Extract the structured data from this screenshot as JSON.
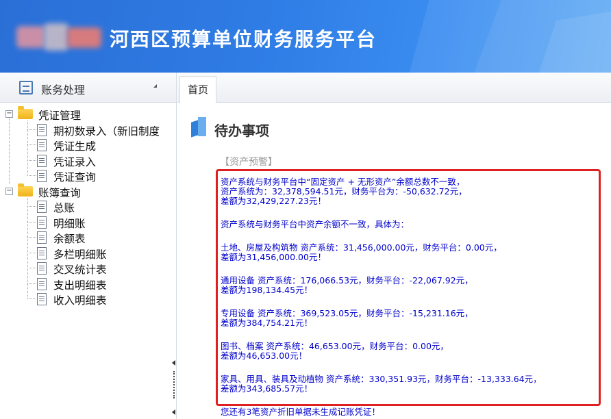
{
  "header": {
    "title": "河西区预算单位财务服务平台"
  },
  "sidebar": {
    "module_label": "账务处理",
    "groups": [
      {
        "label": "凭证管理",
        "expander": "−",
        "items": [
          "期初数录入（新旧制度",
          "凭证生成",
          "凭证录入",
          "凭证查询"
        ]
      },
      {
        "label": "账簿查询",
        "expander": "−",
        "items": [
          "总账",
          "明细账",
          "余额表",
          "多栏明细账",
          "交叉统计表",
          "支出明细表",
          "收入明细表"
        ]
      }
    ]
  },
  "tabs": [
    {
      "label": "首页"
    }
  ],
  "main": {
    "todo_title": "待办事项",
    "section_label": "【资产预警】",
    "alerts": [
      {
        "lines": [
          "资产系统与财务平台中“固定资产 + 无形资产”余额总数不一致，",
          "资产系统为：32,378,594.51元，财务平台为：-50,632.72元，",
          "差额为32,429,227.23元！"
        ]
      },
      {
        "lines": [
          "资产系统与财务平台中资产余额不一致，具体为："
        ]
      },
      {
        "lines": [
          "土地、房屋及构筑物 资产系统：31,456,000.00元，财务平台：0.00元，",
          "差额为31,456,000.00元！"
        ]
      },
      {
        "lines": [
          "通用设备 资产系统：176,066.53元，财务平台：-22,067.92元，",
          "差额为198,134.45元！"
        ]
      },
      {
        "lines": [
          "专用设备 资产系统：369,523.05元，财务平台：-15,231.16元，",
          "差额为384,754.21元！"
        ]
      },
      {
        "lines": [
          "图书、档案 资产系统：46,653.00元，财务平台：0.00元，",
          "差额为46,653.00元！"
        ]
      },
      {
        "lines": [
          "家具、用具、装具及动植物 资产系统：330,351.93元，财务平台：-13,333.64元，",
          "差额为343,685.57元！"
        ]
      },
      {
        "lines": [
          "您还有3笔资产折旧单据未生成记账凭证！"
        ]
      }
    ]
  },
  "colors": {
    "header_blue": "#2f7de6",
    "alert_border": "#e02020",
    "alert_text": "#0000cc",
    "folder": "#f0b21b"
  }
}
